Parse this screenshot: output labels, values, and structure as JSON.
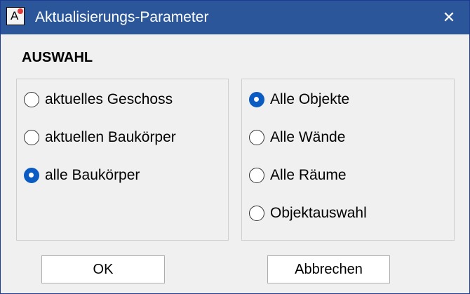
{
  "window": {
    "title": "Aktualisierungs-Parameter",
    "app_icon_letter": "A",
    "close_glyph": "✕",
    "titlebar_color": "#2b579a"
  },
  "section": {
    "title": "AUSWAHL"
  },
  "scope_group": {
    "options": [
      {
        "label": "aktuelles Geschoss",
        "selected": false
      },
      {
        "label": "aktuellen Baukörper",
        "selected": false
      },
      {
        "label": "alle Baukörper",
        "selected": true
      }
    ]
  },
  "object_group": {
    "options": [
      {
        "label": "Alle Objekte",
        "selected": true
      },
      {
        "label": "Alle Wände",
        "selected": false
      },
      {
        "label": "Alle Räume",
        "selected": false
      },
      {
        "label": "Objektauswahl",
        "selected": false
      }
    ]
  },
  "buttons": {
    "ok": "OK",
    "cancel": "Abbrechen"
  },
  "accent_color": "#0a5cc2"
}
